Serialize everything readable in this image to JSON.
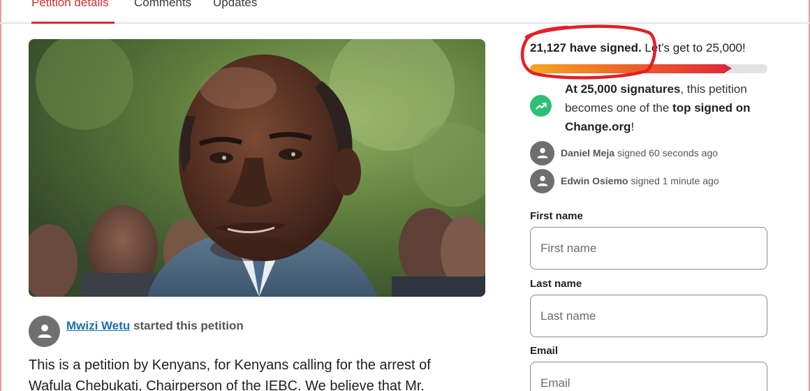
{
  "tabs": [
    {
      "label": "Petition details",
      "active": true
    },
    {
      "label": "Comments",
      "active": false
    },
    {
      "label": "Updates",
      "active": false
    }
  ],
  "petition": {
    "starter_name": "Mwizi Wetu",
    "starter_suffix": " started this petition",
    "description": "This is a petition by Kenyans, for Kenyans calling for the arrest of Wafula Chebukati, Chairperson of the IEBC. We believe that Mr."
  },
  "signatures": {
    "count_text": "21,127 have signed.",
    "goal_text": " Let’s get to 25,000!",
    "progress_fraction": 0.85
  },
  "goal_message": {
    "lead": "At 25,000 signatures",
    "middle": ", this petition becomes one of the ",
    "emphasis": "top signed on Change.org",
    "tail": "!"
  },
  "recent_signers": [
    {
      "name": "Daniel Meja",
      "action": "signed 60 seconds ago"
    },
    {
      "name": "Edwin Osiemo",
      "action": "signed 1 minute ago"
    }
  ],
  "form": {
    "first_name": {
      "label": "First name",
      "placeholder": "First name",
      "value": ""
    },
    "last_name": {
      "label": "Last name",
      "placeholder": "Last name",
      "value": ""
    },
    "email": {
      "label": "Email",
      "placeholder": "Email",
      "value": ""
    }
  },
  "icons": {
    "goal": "trending-up-icon",
    "avatar": "user-avatar-icon"
  },
  "colors": {
    "accent": "#d92c2c",
    "link": "#1a6fb0",
    "goal_icon_bg": "#2bbf78",
    "annotation_circle": "#e0202a"
  }
}
